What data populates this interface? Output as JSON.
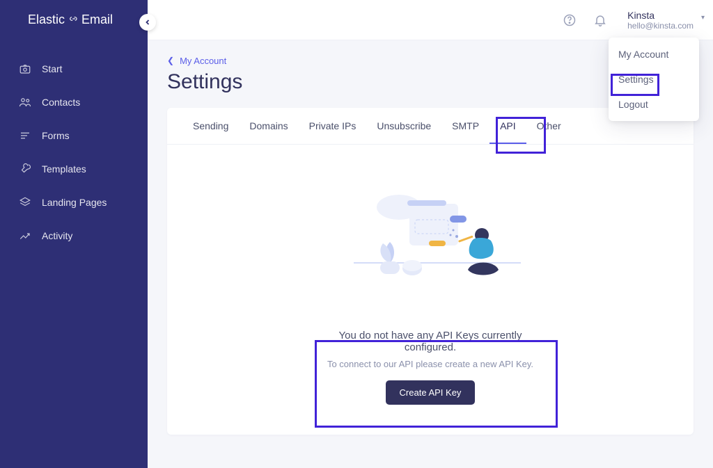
{
  "brand": {
    "word1": "Elastic",
    "word2": "Email"
  },
  "sidebar": {
    "items": [
      {
        "label": "Start"
      },
      {
        "label": "Contacts"
      },
      {
        "label": "Forms"
      },
      {
        "label": "Templates"
      },
      {
        "label": "Landing Pages"
      },
      {
        "label": "Activity"
      }
    ]
  },
  "account": {
    "name": "Kinsta",
    "email": "hello@kinsta.com"
  },
  "dropdown": {
    "items": [
      {
        "label": "My Account"
      },
      {
        "label": "Settings"
      },
      {
        "label": "Logout"
      }
    ]
  },
  "breadcrumb": {
    "label": "My Account"
  },
  "page": {
    "title": "Settings"
  },
  "tabs": [
    {
      "label": "Sending"
    },
    {
      "label": "Domains"
    },
    {
      "label": "Private IPs"
    },
    {
      "label": "Unsubscribe"
    },
    {
      "label": "SMTP"
    },
    {
      "label": "API",
      "active": true
    },
    {
      "label": "Other"
    }
  ],
  "api": {
    "title": "You do not have any API Keys currently configured.",
    "subtitle": "To connect to our API please create a new API Key.",
    "button": "Create API Key"
  }
}
